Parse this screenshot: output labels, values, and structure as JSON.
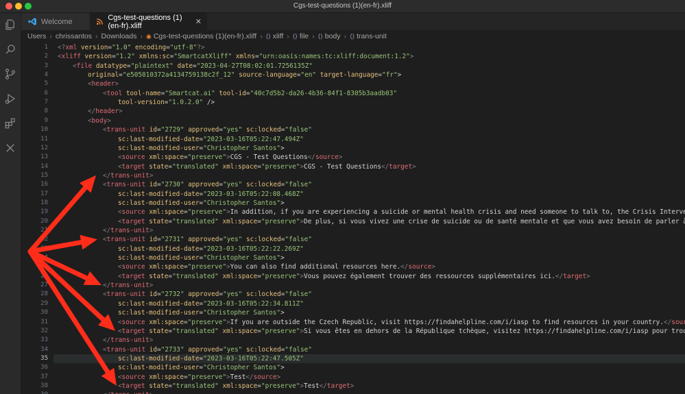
{
  "window": {
    "title": "Cgs-test-questions (1)(en-fr).xliff"
  },
  "activity_bar": {
    "icons": [
      "explorer-icon",
      "search-icon",
      "source-control-icon",
      "run-debug-icon",
      "extensions-icon",
      "remote-icon"
    ]
  },
  "tabs": [
    {
      "label": "Welcome",
      "icon": "vscode-logo-icon"
    },
    {
      "label": "Cgs-test-questions (1)(en-fr).xliff",
      "icon": "rss-file-icon"
    }
  ],
  "breadcrumb": [
    "Users",
    "chrissantos",
    "Downloads",
    "Cgs-test-questions (1)(en-fr).xliff",
    "xliff",
    "file",
    "body",
    "trans-unit"
  ],
  "editor": {
    "current_line": 35,
    "lines": [
      {
        "n": 1,
        "indent": 0,
        "text": "<?xml version=\"1.0\" encoding=\"utf-8\"?>"
      },
      {
        "n": 2,
        "indent": 0,
        "text": "<xliff version=\"1.2\" xmlns:sc=\"SmartcatXliff\" xmlns=\"urn:oasis:names:tc:xliff:document:1.2\">"
      },
      {
        "n": 3,
        "indent": 2,
        "text": "<file datatype=\"plaintext\" date=\"2023-04-27T08:02:01.7256135Z\""
      },
      {
        "n": 4,
        "indent": 4,
        "text": "original=\"e505010372a4134759138c2f_12\" source-language=\"en\" target-language=\"fr\">"
      },
      {
        "n": 5,
        "indent": 4,
        "text": "<header>"
      },
      {
        "n": 6,
        "indent": 6,
        "text": "<tool tool-name=\"Smartcat.ai\" tool-id=\"40c7d5b2-da26-4b36-84f1-8305b3aadb03\""
      },
      {
        "n": 7,
        "indent": 8,
        "text": "tool-version=\"1.0.2.0\" />"
      },
      {
        "n": 8,
        "indent": 4,
        "text": "</header>"
      },
      {
        "n": 9,
        "indent": 4,
        "text": "<body>"
      },
      {
        "n": 10,
        "indent": 6,
        "text": "<trans-unit id=\"2729\" approved=\"yes\" sc:locked=\"false\""
      },
      {
        "n": 11,
        "indent": 8,
        "text": "sc:last-modified-date=\"2023-03-16T05:22:47.494Z\""
      },
      {
        "n": 12,
        "indent": 8,
        "text": "sc:last-modified-user=\"Christopher Santos\">"
      },
      {
        "n": 13,
        "indent": 8,
        "text": "<source xml:space=\"preserve\">CGS - Test Questions</source>"
      },
      {
        "n": 14,
        "indent": 8,
        "text": "<target state=\"translated\" xml:space=\"preserve\">CGS - Test Questions</target>"
      },
      {
        "n": 15,
        "indent": 6,
        "text": "</trans-unit>"
      },
      {
        "n": 16,
        "indent": 6,
        "text": "<trans-unit id=\"2730\" approved=\"yes\" sc:locked=\"false\""
      },
      {
        "n": 17,
        "indent": 8,
        "text": "sc:last-modified-date=\"2023-03-16T05:22:08.468Z\""
      },
      {
        "n": 18,
        "indent": 8,
        "text": "sc:last-modified-user=\"Christopher Santos\">"
      },
      {
        "n": 19,
        "indent": 8,
        "text": "<source xml:space=\"preserve\">In addition, if you are experiencing a suicide or mental health crisis and need someone to talk to, the Crisis Intervention"
      },
      {
        "n": 20,
        "indent": 8,
        "text": "<target state=\"translated\" xml:space=\"preserve\">De plus, si vous vivez une crise de suicide ou de santé mentale et que vous avez besoin de parler à quelq"
      },
      {
        "n": 21,
        "indent": 6,
        "text": "</trans-unit>"
      },
      {
        "n": 22,
        "indent": 6,
        "text": "<trans-unit id=\"2731\" approved=\"yes\" sc:locked=\"false\""
      },
      {
        "n": 23,
        "indent": 8,
        "text": "sc:last-modified-date=\"2023-03-16T05:22:22.269Z\""
      },
      {
        "n": 24,
        "indent": 8,
        "text": "sc:last-modified-user=\"Christopher Santos\">"
      },
      {
        "n": 25,
        "indent": 8,
        "text": "<source xml:space=\"preserve\">You can also find additional resources here.</source>"
      },
      {
        "n": 26,
        "indent": 8,
        "text": "<target state=\"translated\" xml:space=\"preserve\">Vous pouvez également trouver des ressources supplémentaires ici.</target>"
      },
      {
        "n": 27,
        "indent": 6,
        "text": "</trans-unit>"
      },
      {
        "n": 28,
        "indent": 6,
        "text": "<trans-unit id=\"2732\" approved=\"yes\" sc:locked=\"false\""
      },
      {
        "n": 29,
        "indent": 8,
        "text": "sc:last-modified-date=\"2023-03-16T05:22:34.811Z\""
      },
      {
        "n": 30,
        "indent": 8,
        "text": "sc:last-modified-user=\"Christopher Santos\">"
      },
      {
        "n": 31,
        "indent": 8,
        "text": "<source xml:space=\"preserve\">If you are outside the Czech Republic, visit https://findahelpline.com/i/iasp to find resources in your country.</source>"
      },
      {
        "n": 32,
        "indent": 8,
        "text": "<target state=\"translated\" xml:space=\"preserve\">Si vous êtes en dehors de la République tchèque, visitez https://findahelpline.com/i/iasp pour trouver de"
      },
      {
        "n": 33,
        "indent": 6,
        "text": "</trans-unit>"
      },
      {
        "n": 34,
        "indent": 6,
        "text": "<trans-unit id=\"2733\" approved=\"yes\" sc:locked=\"false\""
      },
      {
        "n": 35,
        "indent": 8,
        "text": "sc:last-modified-date=\"2023-03-16T05:22:47.505Z\""
      },
      {
        "n": 36,
        "indent": 8,
        "text": "sc:last-modified-user=\"Christopher Santos\">"
      },
      {
        "n": 37,
        "indent": 8,
        "text": "<source xml:space=\"preserve\">Test</source>"
      },
      {
        "n": 38,
        "indent": 8,
        "text": "<target state=\"translated\" xml:space=\"preserve\">Test</target>"
      },
      {
        "n": 39,
        "indent": 6,
        "text": "</trans-unit>"
      }
    ]
  },
  "annotation": {
    "color": "#ff2d1a",
    "arrow_targets": [
      15,
      22,
      27,
      32,
      38
    ]
  }
}
